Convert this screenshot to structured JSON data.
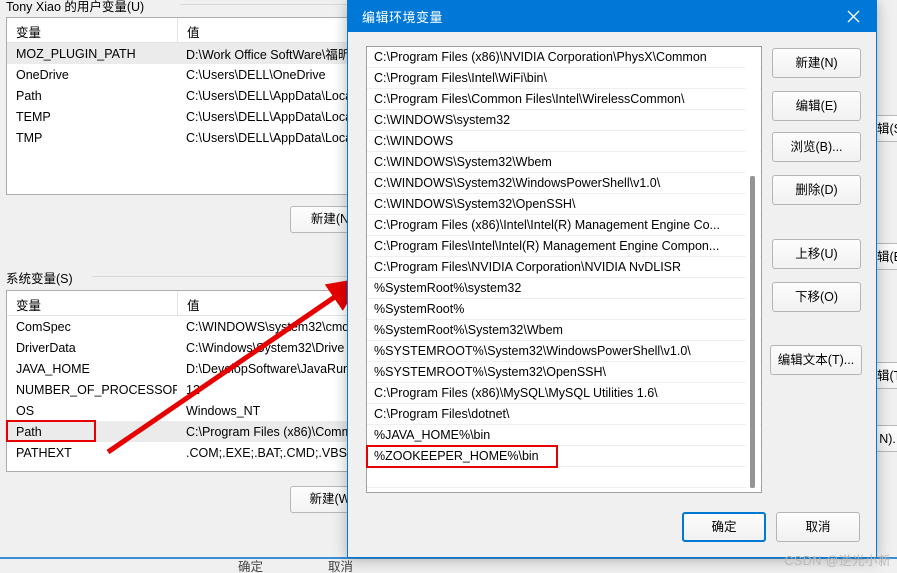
{
  "background_window": {
    "user_vars": {
      "section_label": "Tony Xiao 的用户变量(U)",
      "columns": [
        "变量",
        "值"
      ],
      "rows": [
        {
          "name": "MOZ_PLUGIN_PATH",
          "value": "D:\\Work Office SoftWare\\福昕",
          "selected": true
        },
        {
          "name": "OneDrive",
          "value": "C:\\Users\\DELL\\OneDrive",
          "selected": false
        },
        {
          "name": "Path",
          "value": "C:\\Users\\DELL\\AppData\\Loca",
          "selected": false
        },
        {
          "name": "TEMP",
          "value": "C:\\Users\\DELL\\AppData\\Loca",
          "selected": false
        },
        {
          "name": "TMP",
          "value": "C:\\Users\\DELL\\AppData\\Loca",
          "selected": false
        }
      ],
      "new_button": "新建(N",
      "clipped_buttons": [
        "辑(S)...",
        "辑(E)..."
      ]
    },
    "system_vars": {
      "section_label": "系统变量(S)",
      "columns": [
        "变量",
        "值"
      ],
      "rows": [
        {
          "name": "ComSpec",
          "value": "C:\\WINDOWS\\system32\\cmd",
          "selected": false
        },
        {
          "name": "DriverData",
          "value": "C:\\Windows\\System32\\Drive",
          "selected": false
        },
        {
          "name": "JAVA_HOME",
          "value": "D:\\DevelopSoftware\\JavaRun",
          "selected": false
        },
        {
          "name": "NUMBER_OF_PROCESSORS",
          "value": "12",
          "selected": false
        },
        {
          "name": "OS",
          "value": "Windows_NT",
          "selected": false
        },
        {
          "name": "Path",
          "value": "C:\\Program Files (x86)\\Comm",
          "selected": true
        },
        {
          "name": "PATHEXT",
          "value": ".COM;.EXE;.BAT;.CMD;.VBS;.V",
          "selected": false
        }
      ],
      "new_button": "新建(W",
      "clipped_buttons": [
        "辑(T)...",
        "N)..."
      ]
    },
    "bottom_buttons": [
      "确定",
      "取消"
    ]
  },
  "edit_dialog": {
    "title": "编辑环境变量",
    "close_icon": "close-icon",
    "path_entries": [
      "C:\\Program Files (x86)\\NVIDIA Corporation\\PhysX\\Common",
      "C:\\Program Files\\Intel\\WiFi\\bin\\",
      "C:\\Program Files\\Common Files\\Intel\\WirelessCommon\\",
      "C:\\WINDOWS\\system32",
      "C:\\WINDOWS",
      "C:\\WINDOWS\\System32\\Wbem",
      "C:\\WINDOWS\\System32\\WindowsPowerShell\\v1.0\\",
      "C:\\WINDOWS\\System32\\OpenSSH\\",
      "C:\\Program Files (x86)\\Intel\\Intel(R) Management Engine Co...",
      "C:\\Program Files\\Intel\\Intel(R) Management Engine Compon...",
      "C:\\Program Files\\NVIDIA Corporation\\NVIDIA NvDLISR",
      "%SystemRoot%\\system32",
      "%SystemRoot%",
      "%SystemRoot%\\System32\\Wbem",
      "%SYSTEMROOT%\\System32\\WindowsPowerShell\\v1.0\\",
      "%SYSTEMROOT%\\System32\\OpenSSH\\",
      "C:\\Program Files (x86)\\MySQL\\MySQL Utilities 1.6\\",
      "C:\\Program Files\\dotnet\\",
      "%JAVA_HOME%\\bin",
      "%ZOOKEEPER_HOME%\\bin",
      ""
    ],
    "highlighted_entry_index": 19,
    "side_buttons": [
      "新建(N)",
      "编辑(E)",
      "浏览(B)...",
      "删除(D)",
      "上移(U)",
      "下移(O)",
      "编辑文本(T)..."
    ],
    "ok_button": "确定",
    "cancel_button": "取消"
  },
  "watermark": "CSDN @逆光小新",
  "colors": {
    "titlebar": "#0078d7",
    "accent": "#0078d4",
    "annotation_red": "#e60000",
    "selection_gray": "#ebebeb",
    "window_bg": "#f0f0f0"
  }
}
